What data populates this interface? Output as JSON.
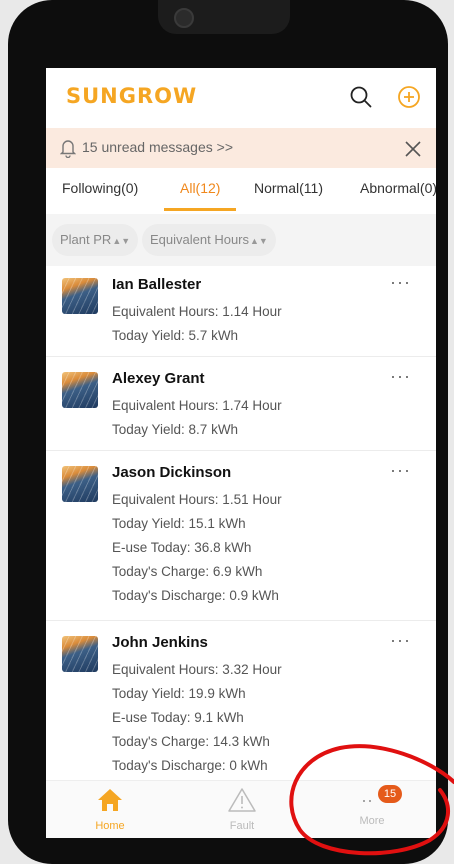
{
  "app": {
    "logo": "SUNGROW",
    "brand_color": "#f5a623",
    "header_icons": [
      "search-icon",
      "add-circle-icon"
    ]
  },
  "banner": {
    "icon": "bell-icon",
    "text": "15 unread messages >>",
    "close_icon": "close-icon"
  },
  "tabs": [
    {
      "label": "Following(0)"
    },
    {
      "label": "All(12)",
      "active": true
    },
    {
      "label": "Normal(11)"
    },
    {
      "label": "Abnormal(0)"
    }
  ],
  "filters": [
    {
      "label": "Plant PR"
    },
    {
      "label": "Equivalent Hours"
    }
  ],
  "plants": [
    {
      "name": "Ian Ballester",
      "lines": [
        "Equivalent Hours: 1.14 Hour",
        "Today Yield: 5.7 kWh"
      ]
    },
    {
      "name": "Alexey Grant",
      "lines": [
        "Equivalent Hours: 1.74 Hour",
        "Today Yield: 8.7 kWh"
      ]
    },
    {
      "name": "Jason Dickinson",
      "lines": [
        "Equivalent Hours: 1.51 Hour",
        "Today Yield: 15.1 kWh",
        "E-use Today: 36.8 kWh",
        "Today's Charge: 6.9 kWh",
        "Today's Discharge: 0.9 kWh"
      ]
    },
    {
      "name": "John Jenkins",
      "lines": [
        "Equivalent Hours: 3.32 Hour",
        "Today Yield: 19.9 kWh",
        "E-use Today: 9.1 kWh",
        "Today's Charge: 14.3 kWh",
        "Today's Discharge: 0 kWh"
      ]
    }
  ],
  "more_menu": "···",
  "bottom_nav": {
    "home": {
      "label": "Home",
      "icon": "home-icon",
      "active": true
    },
    "fault": {
      "label": "Fault",
      "icon": "warning-icon"
    },
    "more": {
      "label": "More",
      "icon": "more-icon",
      "badge": "15",
      "dots": "··"
    }
  },
  "colors": {
    "accent": "#f5a623",
    "banner_bg": "#fbeadf",
    "badge": "#e55a1a",
    "annotation": "#e01010"
  }
}
